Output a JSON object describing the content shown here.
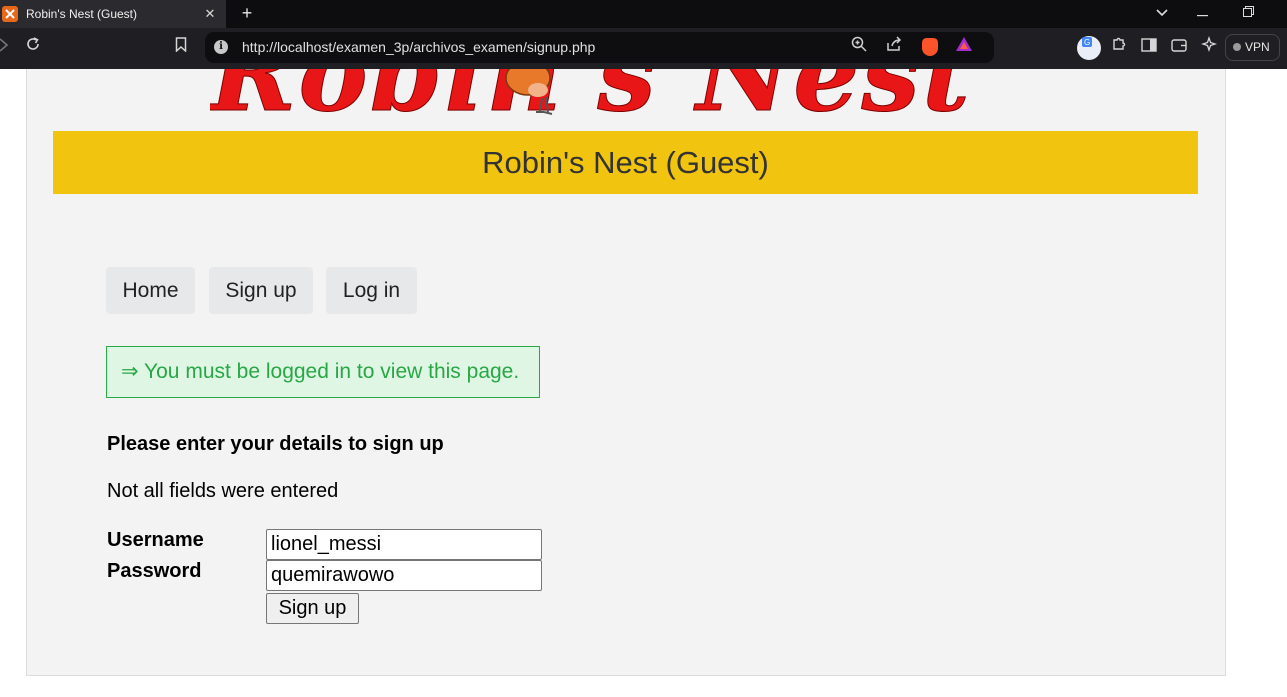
{
  "browser": {
    "tab_title": "Robin's Nest (Guest)",
    "url": "http://localhost/examen_3p/archivos_examen/signup.php",
    "vpn_label": "VPN"
  },
  "page": {
    "logo_text": "Robin's Nest",
    "banner_title": "Robin's Nest (Guest)",
    "nav": [
      "Home",
      "Sign up",
      "Log in"
    ],
    "notice": "⇒ You must be logged in to view this page.",
    "heading": "Please enter your details to sign up",
    "error": "Not all fields were entered",
    "form": {
      "username_label": "Username",
      "username_value": "lionel_messi",
      "password_label": "Password",
      "password_value": "quemirawowo",
      "submit_label": "Sign up"
    }
  },
  "colors": {
    "banner": "#f1c40f",
    "notice_text": "#28a745",
    "notice_bg": "#dff6e4",
    "logo_red": "#e81616"
  }
}
